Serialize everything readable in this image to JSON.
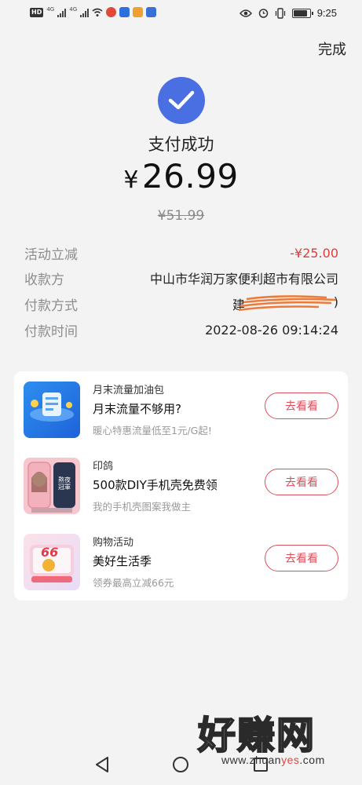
{
  "status_bar": {
    "badge": "HD",
    "signal_label_1": "4G",
    "signal_label_2": "4G",
    "time": "9:25"
  },
  "header": {
    "done_label": "完成"
  },
  "payment": {
    "title": "支付成功",
    "currency": "¥",
    "amount": "26.99",
    "original_amount": "¥51.99"
  },
  "details": [
    {
      "label": "活动立减",
      "value": "-¥25.00",
      "emphasis": "red"
    },
    {
      "label": "收款方",
      "value": "中山市华润万家便利超市有限公司"
    },
    {
      "label": "付款方式",
      "value": "建",
      "value_suffix": ")"
    },
    {
      "label": "付款时间",
      "value": "2022-08-26 09:14:24"
    }
  ],
  "promos": [
    {
      "category": "月末流量加油包",
      "title": "月末流量不够用?",
      "subtitle": "暖心特惠流量低至1元/G起!",
      "button": "去看看",
      "icon": "data-package-icon"
    },
    {
      "category": "印鸽",
      "title": "500款DIY手机壳免费领",
      "subtitle": "我的手机壳图案我做主",
      "button": "去看看",
      "icon": "phone-case-icon",
      "badge": "熬夜冠軍"
    },
    {
      "category": "购物活动",
      "title": "美好生活季",
      "subtitle": "领券最高立减66元",
      "button": "去看看",
      "icon": "coupon-icon",
      "badge": "66"
    }
  ],
  "watermark": {
    "text": "好赚网",
    "url_prefix": "www.zhuan",
    "url_highlight": "yes",
    "url_suffix": ".com"
  },
  "colors": {
    "accent_blue": "#4a6fe3",
    "discount_red": "#e23b3b",
    "button_red": "#d9505c"
  }
}
